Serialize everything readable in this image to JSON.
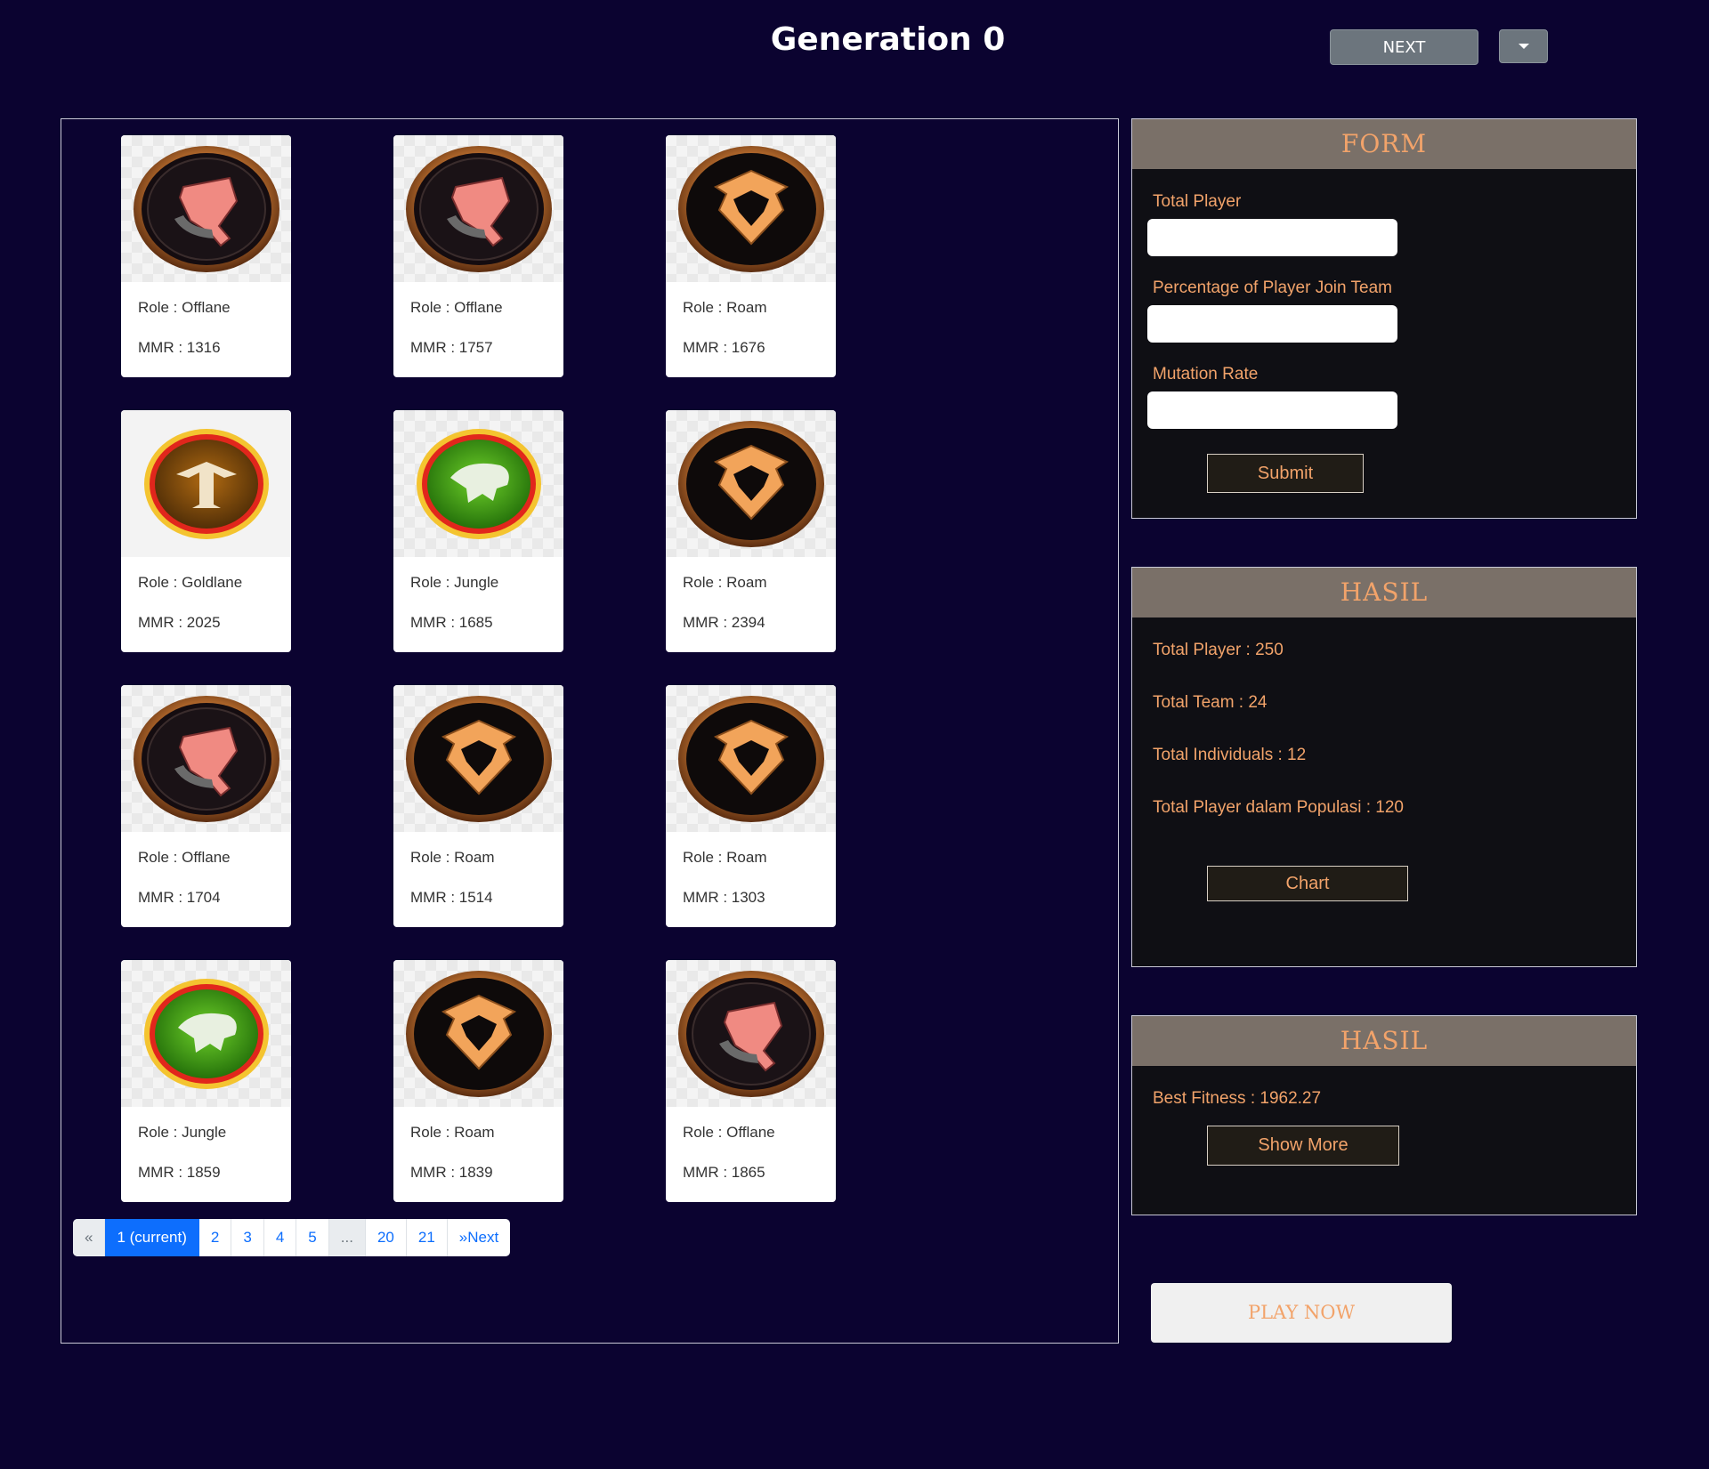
{
  "header": {
    "title": "Generation 0",
    "next_label": "NEXT",
    "dropdown_icon": "caret-down-icon"
  },
  "cards": [
    {
      "role": "Role : Offlane",
      "mmr": "MMR : 1316",
      "icon": "offlane-role-icon"
    },
    {
      "role": "Role : Offlane",
      "mmr": "MMR : 1757",
      "icon": "offlane-role-icon"
    },
    {
      "role": "Role : Roam",
      "mmr": "MMR : 1676",
      "icon": "roam-role-icon"
    },
    {
      "role": "Role : Goldlane",
      "mmr": "MMR : 2025",
      "icon": "goldlane-role-icon"
    },
    {
      "role": "Role : Jungle",
      "mmr": "MMR : 1685",
      "icon": "jungle-role-icon"
    },
    {
      "role": "Role : Roam",
      "mmr": "MMR : 2394",
      "icon": "roam-role-icon"
    },
    {
      "role": "Role : Offlane",
      "mmr": "MMR : 1704",
      "icon": "offlane-role-icon"
    },
    {
      "role": "Role : Roam",
      "mmr": "MMR : 1514",
      "icon": "roam-role-icon"
    },
    {
      "role": "Role : Roam",
      "mmr": "MMR : 1303",
      "icon": "roam-role-icon"
    },
    {
      "role": "Role : Jungle",
      "mmr": "MMR : 1859",
      "icon": "jungle-role-icon"
    },
    {
      "role": "Role : Roam",
      "mmr": "MMR : 1839",
      "icon": "roam-role-icon"
    },
    {
      "role": "Role : Offlane",
      "mmr": "MMR : 1865",
      "icon": "offlane-role-icon"
    }
  ],
  "pagination": {
    "prev": "«",
    "pages": [
      "1 (current)",
      "2",
      "3",
      "4",
      "5",
      "...",
      "20",
      "21"
    ],
    "next": "»Next"
  },
  "form": {
    "title": "FORM",
    "total_player_label": "Total Player",
    "total_player_value": "",
    "percentage_label": "Percentage of Player Join Team",
    "percentage_value": "",
    "mutation_label": "Mutation Rate",
    "mutation_value": "",
    "submit_label": "Submit"
  },
  "hasil1": {
    "title": "HASIL",
    "total_player": "Total Player : 250",
    "total_team": "Total Team : 24",
    "total_individuals": "Total Individuals : 12",
    "total_populasi": "Total Player dalam Populasi : 120",
    "chart_label": "Chart"
  },
  "hasil2": {
    "title": "HASIL",
    "best_fitness": "Best Fitness : 1962.27",
    "show_more_label": "Show More"
  },
  "play_label": "PLAY NOW",
  "colors": {
    "background": "#0b0330",
    "accent": "#f2a36a",
    "panel_header": "#7a7068",
    "pagination_active": "#0d6efd"
  }
}
